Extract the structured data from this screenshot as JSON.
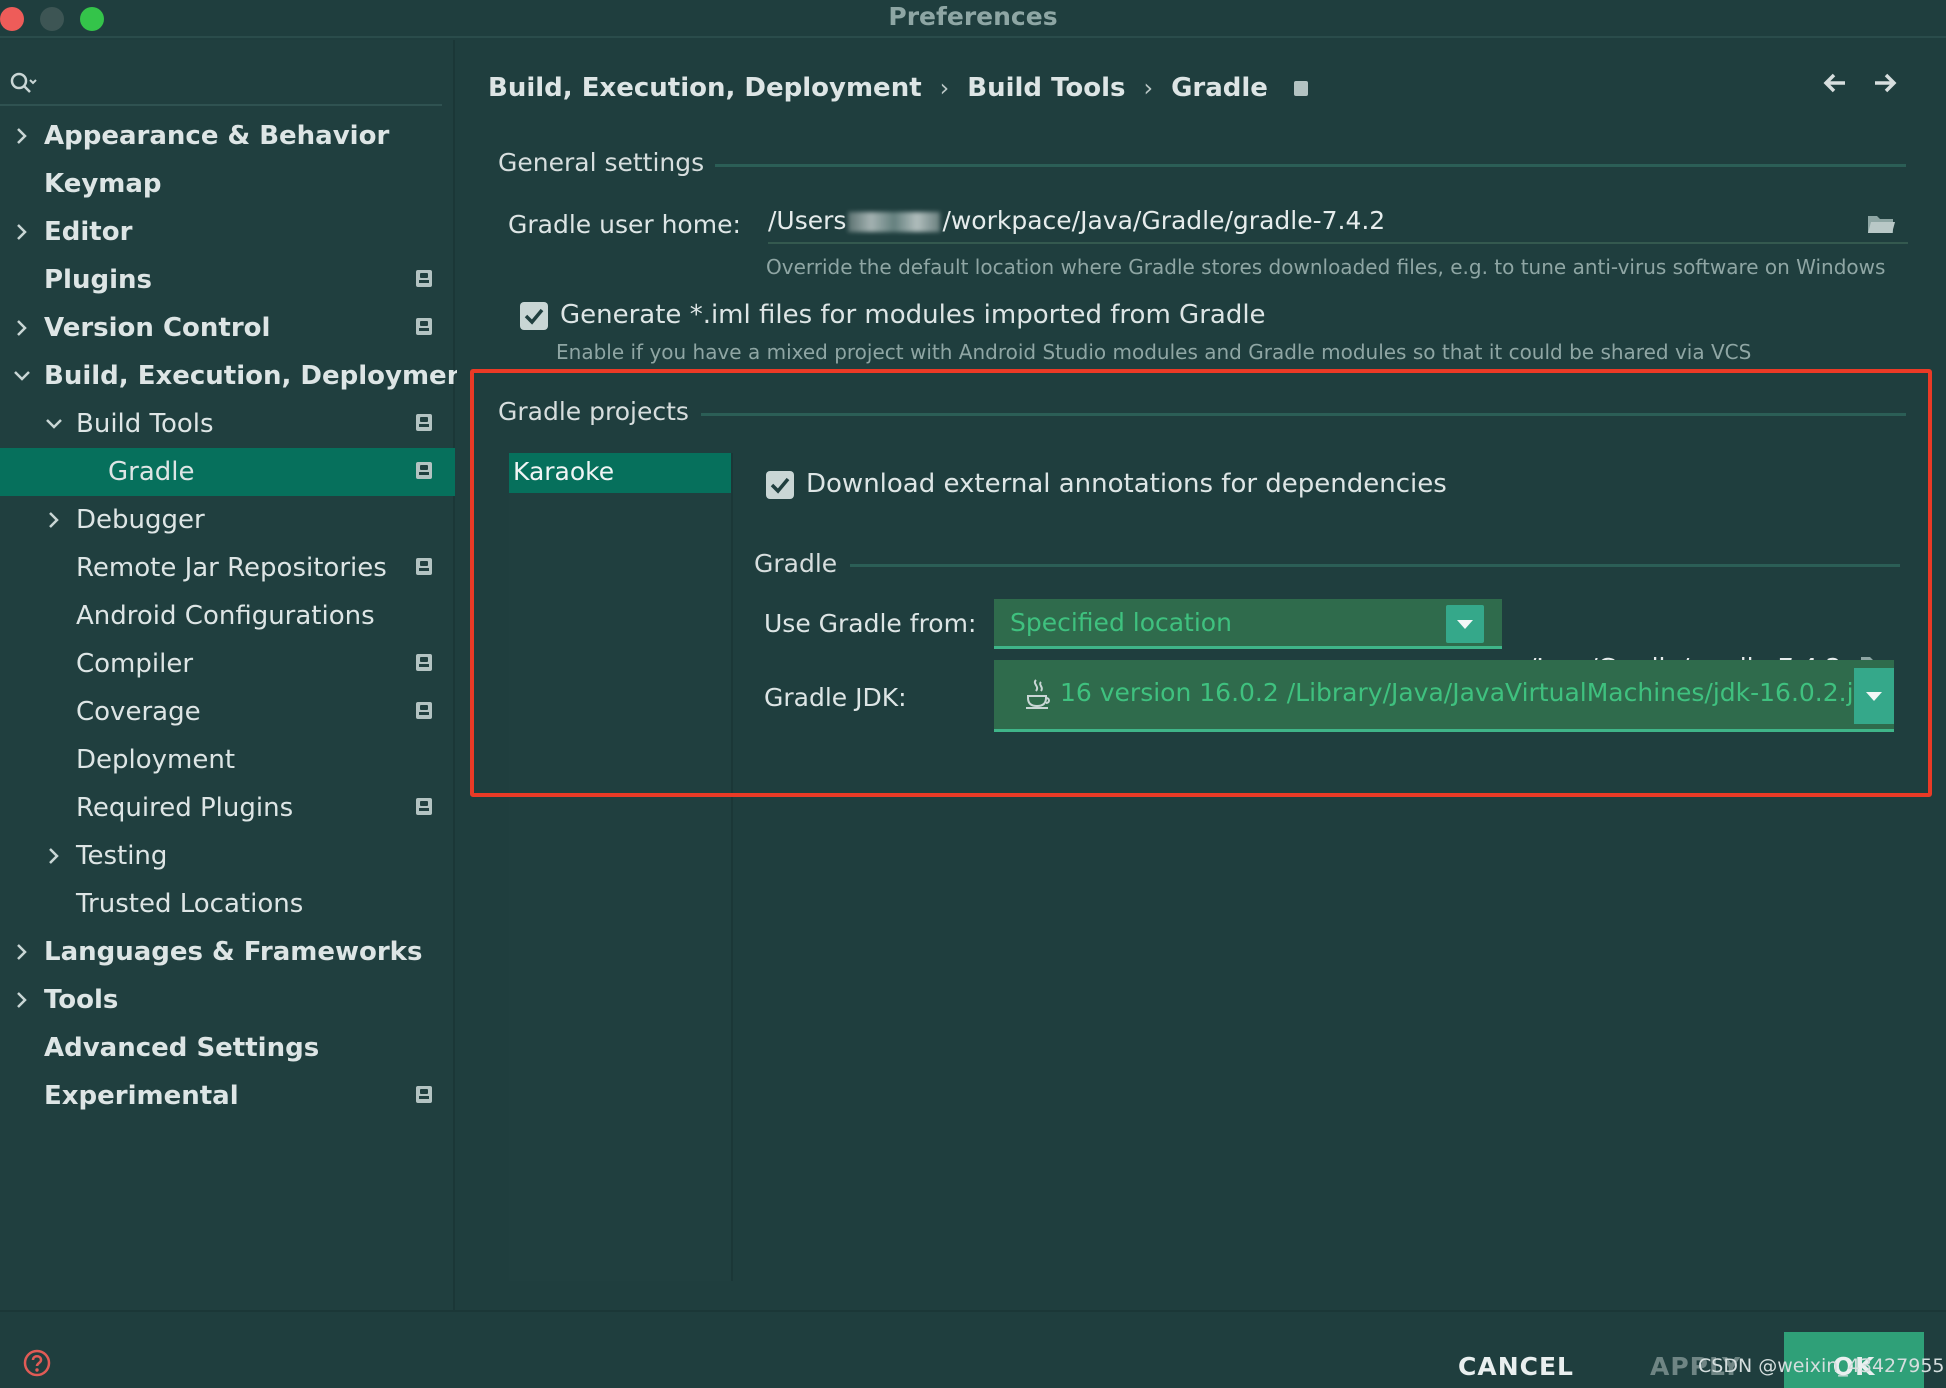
{
  "window": {
    "title": "Preferences"
  },
  "search": {
    "placeholder": ""
  },
  "sidebar": {
    "items": [
      {
        "label": "Appearance & Behavior",
        "level": 0,
        "expand": "collapsed",
        "badge": false
      },
      {
        "label": "Keymap",
        "level": 0,
        "expand": "none",
        "badge": false
      },
      {
        "label": "Editor",
        "level": 0,
        "expand": "collapsed",
        "badge": false
      },
      {
        "label": "Plugins",
        "level": 0,
        "expand": "none",
        "badge": true
      },
      {
        "label": "Version Control",
        "level": 0,
        "expand": "collapsed",
        "badge": true
      },
      {
        "label": "Build, Execution, Deployment",
        "level": 0,
        "expand": "expanded",
        "badge": false
      },
      {
        "label": "Build Tools",
        "level": 1,
        "expand": "expanded",
        "badge": true
      },
      {
        "label": "Gradle",
        "level": 2,
        "expand": "none",
        "badge": true,
        "selected": true
      },
      {
        "label": "Debugger",
        "level": 1,
        "expand": "collapsed",
        "badge": false
      },
      {
        "label": "Remote Jar Repositories",
        "level": 1,
        "expand": "none",
        "badge": true
      },
      {
        "label": "Android Configurations",
        "level": 1,
        "expand": "none",
        "badge": false
      },
      {
        "label": "Compiler",
        "level": 1,
        "expand": "none",
        "badge": true
      },
      {
        "label": "Coverage",
        "level": 1,
        "expand": "none",
        "badge": true
      },
      {
        "label": "Deployment",
        "level": 1,
        "expand": "none",
        "badge": false
      },
      {
        "label": "Required Plugins",
        "level": 1,
        "expand": "none",
        "badge": true
      },
      {
        "label": "Testing",
        "level": 1,
        "expand": "collapsed",
        "badge": false
      },
      {
        "label": "Trusted Locations",
        "level": 1,
        "expand": "none",
        "badge": false
      },
      {
        "label": "Languages & Frameworks",
        "level": 0,
        "expand": "collapsed",
        "badge": false
      },
      {
        "label": "Tools",
        "level": 0,
        "expand": "collapsed",
        "badge": false
      },
      {
        "label": "Advanced Settings",
        "level": 0,
        "expand": "none",
        "badge": false
      },
      {
        "label": "Experimental",
        "level": 0,
        "expand": "none",
        "badge": true
      }
    ]
  },
  "breadcrumb": {
    "part1": "Build, Execution, Deployment",
    "part2": "Build Tools",
    "part3": "Gradle",
    "sep": "›"
  },
  "general": {
    "title": "General settings",
    "user_home_label": "Gradle user home:",
    "user_home_prefix": "/Users",
    "user_home_suffix": "/workpace/Java/Gradle/gradle-7.4.2",
    "user_home_hint": "Override the default location where Gradle stores downloaded files, e.g. to tune anti-virus software on Windows",
    "iml_label": "Generate *.iml files for modules imported from Gradle",
    "iml_checked": true,
    "iml_hint": "Enable if you have a mixed project with Android Studio modules and Gradle modules so that it could be shared via VCS"
  },
  "projects": {
    "title": "Gradle projects",
    "list": [
      "Karaoke"
    ],
    "download_annotations_label": "Download external annotations for dependencies",
    "download_annotations_checked": true,
    "gradle_section_title": "Gradle",
    "use_gradle_from_label": "Use Gradle from:",
    "use_gradle_from_value": "Specified location",
    "gradle_home_path": "/Java/Gradle/gradle-7.4.2",
    "jdk_label": "Gradle JDK:",
    "jdk_value": "16 version 16.0.2 /Library/Java/JavaVirtualMachines/jdk-16.0.2.j"
  },
  "footer": {
    "cancel": "CANCEL",
    "apply": "APPLY",
    "ok": "OK"
  },
  "watermark": "CSDN @weixin_43427955",
  "colors": {
    "accent": "#06705c",
    "highlight": "#ea3a26",
    "combo_text": "#3fc17f"
  }
}
